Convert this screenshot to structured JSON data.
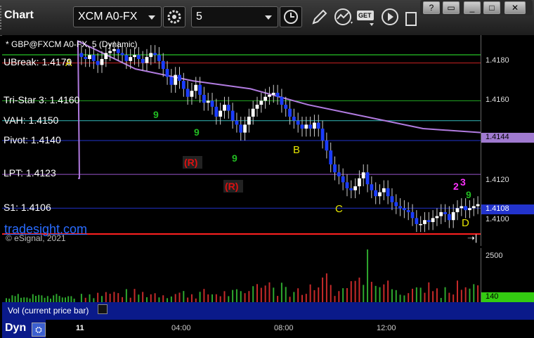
{
  "window": {
    "title": "Chart",
    "symbol": "XCM A0-FX",
    "interval": "5",
    "get_label": "GET",
    "buttons": [
      "?",
      "▭",
      "_",
      "□",
      "✕"
    ]
  },
  "chart_header": "* GBP@FXCM A0-FX, 5 (Dynamic)",
  "watermark": {
    "site": "tradesight.com",
    "copyright": "© eSignal, 2021"
  },
  "levels": [
    {
      "name": "UBreak",
      "text": "UBreak: 1.4179",
      "value": 1.4179,
      "color": "#cc2222"
    },
    {
      "name": "Tri-Star 3",
      "text": "Tri-Star 3: 1.4160",
      "value": 1.416,
      "color": "#22aa22"
    },
    {
      "name": "VAH",
      "text": "VAH: 1.4150",
      "value": 1.415,
      "color": "#33bbbb"
    },
    {
      "name": "Pivot",
      "text": "Pivot: 1.4140",
      "value": 1.414,
      "color": "#2233cc"
    },
    {
      "name": "LPT",
      "text": "LPT: 1.4123",
      "value": 1.4123,
      "color": "#9955cc"
    },
    {
      "name": "S1",
      "text": "S1: 1.4106",
      "value": 1.4106,
      "color": "#2233cc"
    }
  ],
  "price_axis": {
    "ticks": [
      "1.4180",
      "1.4160",
      "1.4140",
      "1.4120",
      "1.4100"
    ],
    "tick_values": [
      1.418,
      1.416,
      1.414,
      1.412,
      1.41
    ]
  },
  "badges": {
    "ma": "1.4144",
    "last": "1.4108",
    "volume": "140"
  },
  "volume_axis": {
    "top_label": "2500",
    "label": "Vol (current price bar)"
  },
  "time_axis": {
    "labels": [
      "11",
      "04:00",
      "08:00",
      "12:00"
    ],
    "corner": "Dyn"
  },
  "markers": {
    "A": "A",
    "B": "B",
    "C": "C",
    "D": "D",
    "R": "(R)"
  },
  "chart_data": {
    "type": "candlestick",
    "title": "* GBP@FXCM A0-FX, 5 (Dynamic)",
    "x_labels": [
      "11",
      "04:00",
      "08:00",
      "12:00"
    ],
    "ylim": [
      1.4087,
      1.4193
    ],
    "close": [
      1.4182,
      1.4181,
      1.4183,
      1.418,
      1.4178,
      1.4181,
      1.4184,
      1.4185,
      1.4186,
      1.4184,
      1.4183,
      1.418,
      1.4182,
      1.4183,
      1.4181,
      1.4179,
      1.4182,
      1.4184,
      1.4183,
      1.418,
      1.4176,
      1.4172,
      1.4168,
      1.4173,
      1.417,
      1.4166,
      1.4162,
      1.4165,
      1.4168,
      1.4163,
      1.4159,
      1.416,
      1.4157,
      1.4152,
      1.4155,
      1.4158,
      1.4155,
      1.415,
      1.4148,
      1.4144,
      1.4148,
      1.4152,
      1.4156,
      1.4158,
      1.416,
      1.4162,
      1.4163,
      1.4164,
      1.4162,
      1.4158,
      1.4156,
      1.4152,
      1.415,
      1.4148,
      1.4146,
      1.4148,
      1.4146,
      1.4149,
      1.4146,
      1.414,
      1.4135,
      1.4128,
      1.4124,
      1.4122,
      1.4119,
      1.4116,
      1.4115,
      1.4117,
      1.4121,
      1.4124,
      1.4118,
      1.4115,
      1.4112,
      1.4114,
      1.4116,
      1.4112,
      1.4109,
      1.4107,
      1.4106,
      1.4105,
      1.4104,
      1.4101,
      1.4098,
      1.4098,
      1.41,
      1.4099,
      1.4101,
      1.4102,
      1.4104,
      1.4103,
      1.41,
      1.4104,
      1.4106,
      1.4107,
      1.4105,
      1.4106,
      1.4107,
      1.4108
    ],
    "moving_average": [
      1.419,
      1.4176,
      1.417,
      1.4166,
      1.4158,
      1.4152,
      1.4146,
      1.4144
    ],
    "volume_ylim": [
      0,
      2500
    ],
    "volume_spike": 2500
  }
}
